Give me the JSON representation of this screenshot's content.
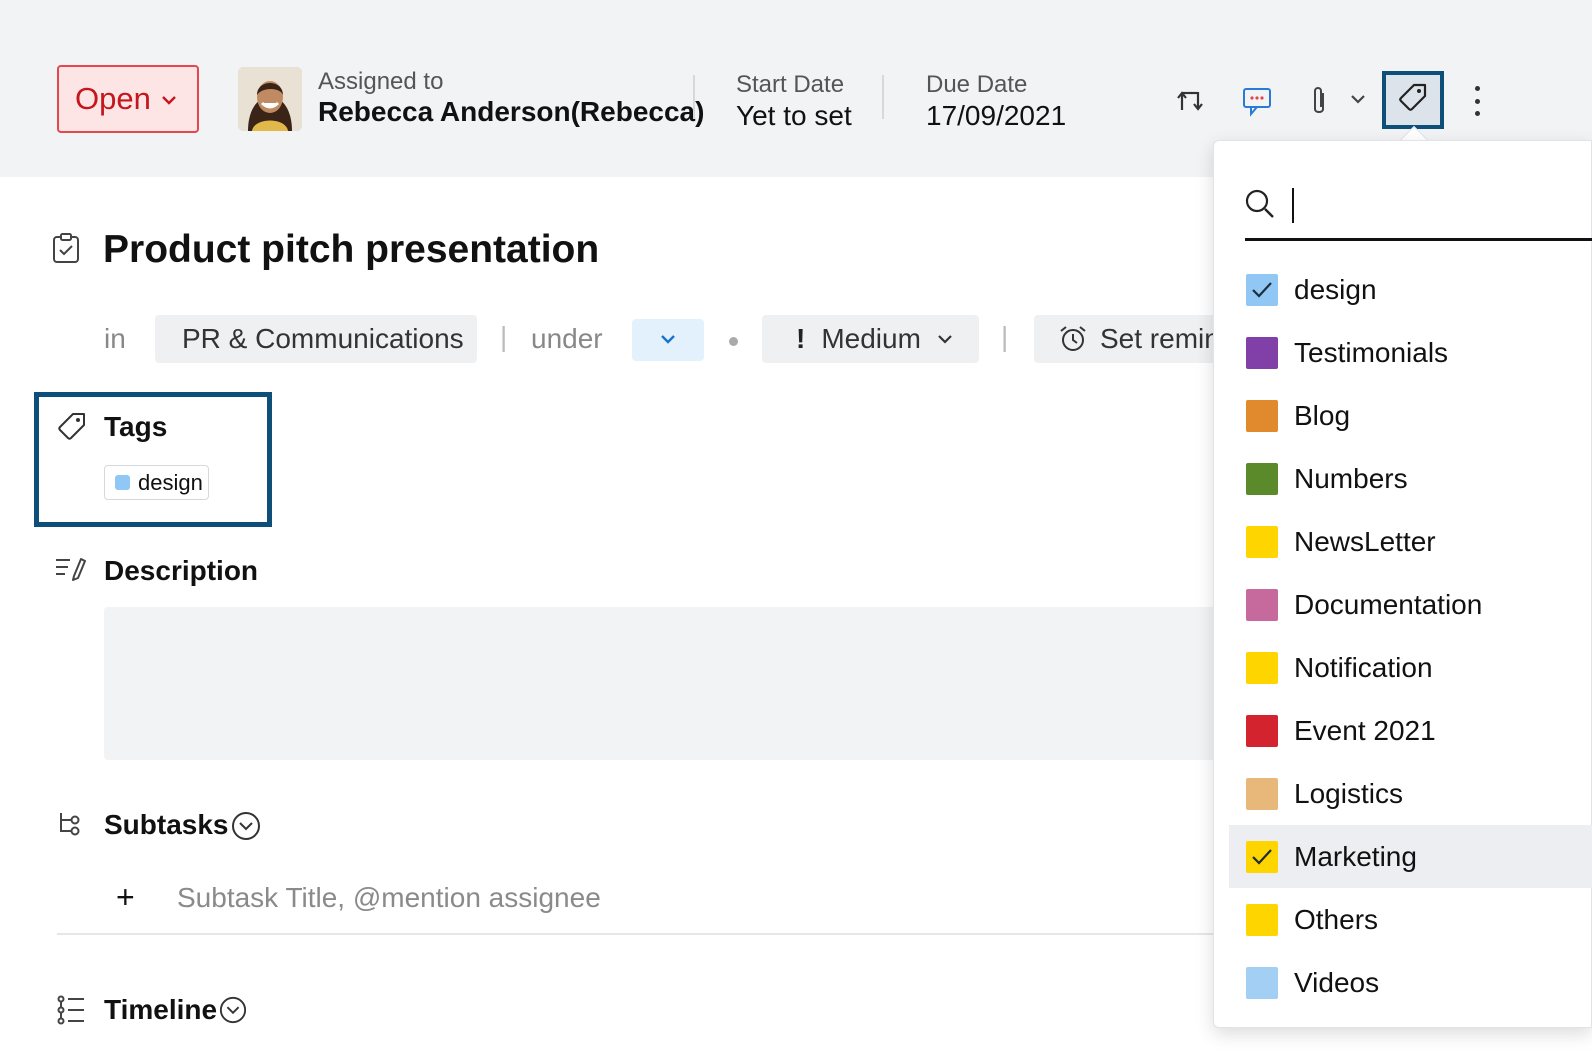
{
  "header": {
    "status": "Open",
    "assigned_label": "Assigned to",
    "assignee": "Rebecca Anderson(Rebecca)",
    "start_label": "Start Date",
    "start_value": "Yet to set",
    "due_label": "Due Date",
    "due_value": "17/09/2021",
    "icons": [
      "swap-icon",
      "comment-icon",
      "paperclip-icon",
      "chevron-down-icon",
      "tag-icon",
      "more-icon"
    ]
  },
  "task": {
    "title": "Product pitch presentation",
    "in_label": "in",
    "project": "PR & Communications",
    "under_label": "under",
    "priority": "Medium",
    "reminder": "Set remin"
  },
  "tags": {
    "title": "Tags",
    "items": [
      "design"
    ]
  },
  "description": {
    "title": "Description"
  },
  "subtasks": {
    "title": "Subtasks",
    "placeholder": "Subtask Title, @mention assignee"
  },
  "timeline": {
    "title": "Timeline"
  },
  "tag_dropdown": {
    "search_value": "",
    "items": [
      {
        "label": "design",
        "color": "#90c7f5",
        "checked": true
      },
      {
        "label": "Testimonials",
        "color": "#8140a8",
        "checked": false
      },
      {
        "label": "Blog",
        "color": "#e08a2d",
        "checked": false
      },
      {
        "label": "Numbers",
        "color": "#5a8a2a",
        "checked": false
      },
      {
        "label": "NewsLetter",
        "color": "#ffd500",
        "checked": false
      },
      {
        "label": "Documentation",
        "color": "#c66a9d",
        "checked": false
      },
      {
        "label": "Notification",
        "color": "#ffd500",
        "checked": false
      },
      {
        "label": "Event 2021",
        "color": "#d2232e",
        "checked": false
      },
      {
        "label": "Logistics",
        "color": "#e8b87a",
        "checked": false
      },
      {
        "label": "Marketing",
        "color": "#ffd500",
        "checked": true,
        "highlighted": true
      },
      {
        "label": "Others",
        "color": "#ffd500",
        "checked": false
      },
      {
        "label": "Videos",
        "color": "#a3cff5",
        "checked": false
      }
    ]
  }
}
